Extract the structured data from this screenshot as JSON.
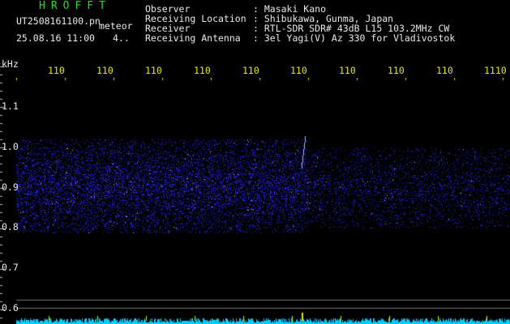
{
  "header": {
    "app_title": "HROFFT",
    "file_name": "UT2508161100.pn",
    "meteor_label": "meteor",
    "date_time": "25.08.16 11:00",
    "count": "4..",
    "info": [
      {
        "key": "Observer",
        "value": ": Masaki Kano"
      },
      {
        "key": "Receiving Location",
        "value": ": Shibukawa, Gunma, Japan"
      },
      {
        "key": "Receiver",
        "value": ": RTL-SDR SDR# 43dB L15 103.2MHz CW"
      },
      {
        "key": "Receiving Antenna",
        "value": ": 3el Yagi(V) Az 330 for Vladivostok"
      }
    ]
  },
  "y_axis": {
    "unit": "kHz",
    "ticks": [
      "1.1",
      "1.0",
      "0.9",
      "0.8",
      "0.7",
      "0.6"
    ]
  },
  "x_axis": {
    "ticks": [
      "110",
      "110",
      "110",
      "110",
      "110",
      "110",
      "110",
      "110",
      "110",
      "1110"
    ]
  },
  "colors": {
    "background": "#000000",
    "title": "#22dd22",
    "axis_x_labels": "#e8e800",
    "text": "#e8e8e8",
    "signal": "#2a2aff",
    "signal_bright": "#aabbff",
    "baseline": "#00ccff"
  }
}
